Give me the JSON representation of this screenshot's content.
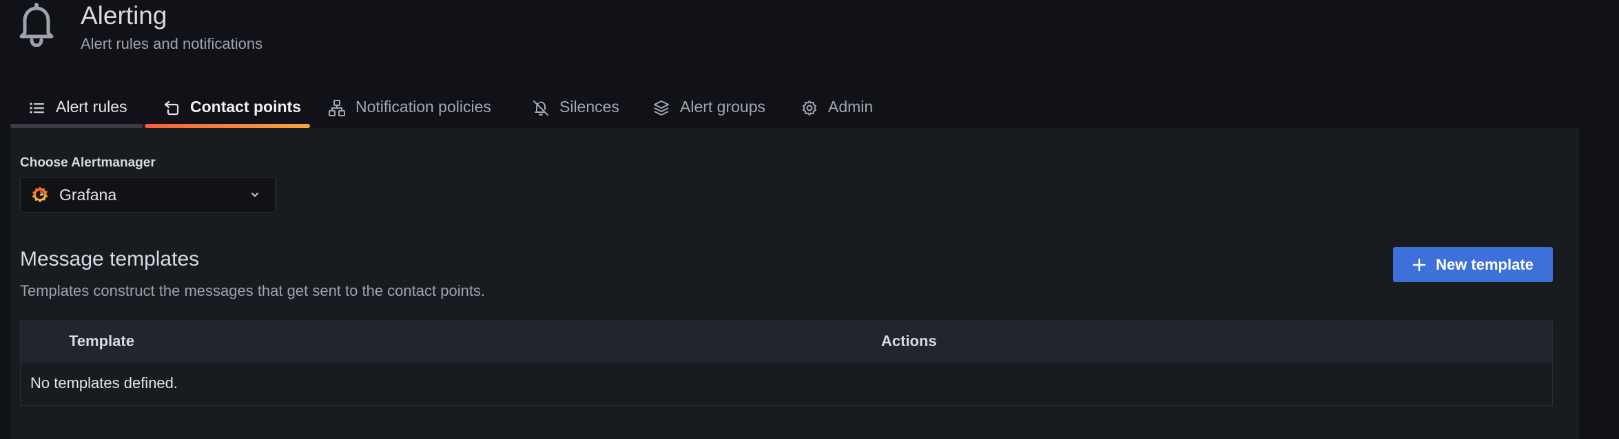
{
  "header": {
    "icon": "bell-icon",
    "title": "Alerting",
    "subtitle": "Alert rules and notifications"
  },
  "tabs": [
    {
      "label": "Alert rules",
      "icon": "list-icon"
    },
    {
      "label": "Contact points",
      "icon": "comment-alt-share-icon",
      "active": true
    },
    {
      "label": "Notification policies",
      "icon": "sitemap-icon"
    },
    {
      "label": "Silences",
      "icon": "bell-slash-icon"
    },
    {
      "label": "Alert groups",
      "icon": "layer-group-icon"
    },
    {
      "label": "Admin",
      "icon": "cog-icon"
    }
  ],
  "alertmanager": {
    "label": "Choose Alertmanager",
    "selected": "Grafana",
    "icon": "grafana-logo-icon"
  },
  "templates": {
    "title": "Message templates",
    "description": "Templates construct the messages that get sent to the contact points.",
    "new_button": "New template",
    "columns": [
      "Template",
      "Actions"
    ],
    "empty": "No templates defined."
  },
  "colors": {
    "background": "#111217",
    "panel": "#181b1f",
    "primary": "#3d71d9",
    "active_tab_gradient": [
      "#f55f3e",
      "#f8a43d"
    ]
  }
}
